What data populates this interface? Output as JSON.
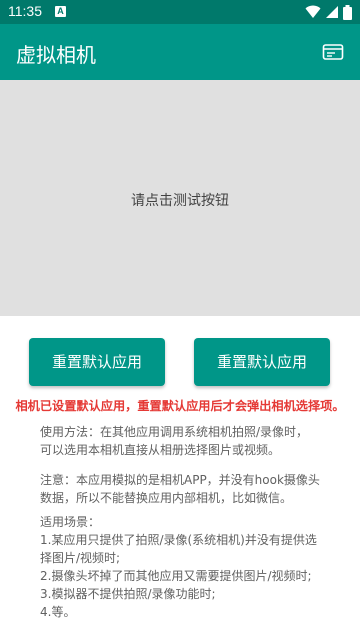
{
  "status_bar": {
    "time": "11:35",
    "app_icon_letter": "A",
    "icons": [
      "wifi-icon",
      "signal-icon",
      "battery-icon"
    ]
  },
  "app_bar": {
    "title": "虚拟相机",
    "action_icon": "card-icon"
  },
  "preview": {
    "hint": "请点击测试按钮"
  },
  "buttons": {
    "left_label": "重置默认应用",
    "right_label": "重置默认应用"
  },
  "warning": "相机已设置默认应用，重置默认应用后才会弹出相机选择项。",
  "info": {
    "usage": [
      "使用方法：在其他应用调用系统相机拍照/录像时，",
      "可以选用本相机直接从相册选择图片或视频。"
    ],
    "note": [
      "注意：本应用模拟的是相机APP，并没有hook摄像头",
      "数据，所以不能替换应用内部相机，比如微信。"
    ],
    "scenes": [
      "适用场景：",
      "1.某应用只提供了拍照/录像(系统相机)并没有提供选",
      "择图片/视频时;",
      "2.摄像头坏掉了而其他应用又需要提供图片/视频时;",
      "3.模拟器不提供拍照/录像功能时;",
      "4.等。"
    ]
  },
  "colors": {
    "status_bar": "#00796b",
    "app_bar": "#009688",
    "button": "#009688",
    "warning": "#e53935",
    "preview_bg": "#e0e0e0"
  }
}
